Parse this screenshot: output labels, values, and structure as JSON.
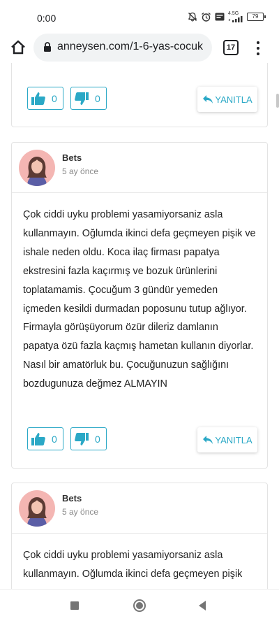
{
  "status_bar": {
    "time": "0:00",
    "network_label": "4.5G",
    "battery_level": "79",
    "icons": [
      "bell-off-icon",
      "alarm-icon",
      "volte-icon",
      "signal-icon",
      "battery-icon"
    ]
  },
  "browser": {
    "url": "anneysen.com/1-6-yas-cocuk",
    "tab_count": "17"
  },
  "colors": {
    "accent": "#2aa8c6",
    "card_border": "#e3e3e3",
    "muted_text": "#8a8a8a"
  },
  "comments": [
    {
      "likes": "0",
      "dislikes": "0",
      "reply_label": "YANITLA"
    },
    {
      "author": "Bets",
      "time": "5 ay önce",
      "text": "Çok ciddi uyku problemi yasamiyorsaniz asla kullanmayın. Oğlumda ikinci defa geçmeyen pişik ve ishale neden oldu. Koca ilaç firması papatya ekstresini fazla kaçırmış ve bozuk ürünlerini toplatamamis. Çocuğum 3 gündür yemeden içmeden kesildi durmadan poposunu tutup ağlıyor. Firmayla görüşüyorum özür dileriz damlanın papatya özü fazla kaçmış hametan kullanın diyorlar. Nasıl bir amatörluk bu. Çocuğunuzun sağlığını bozdugunuza değmez ALMAYIN",
      "likes": "0",
      "dislikes": "0",
      "reply_label": "YANITLA"
    },
    {
      "author": "Bets",
      "time": "5 ay önce",
      "text": "Çok ciddi uyku problemi yasamiyorsaniz asla kullanmayın. Oğlumda ikinci defa geçmeyen pişik"
    }
  ]
}
